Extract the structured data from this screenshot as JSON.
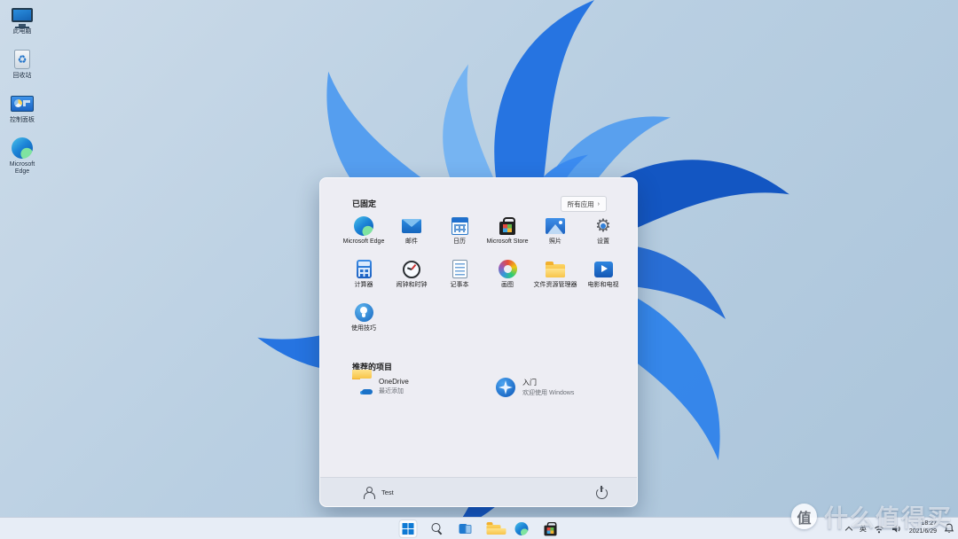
{
  "desktop": {
    "icons": [
      {
        "label": "此电脑",
        "icon": "this-pc-icon"
      },
      {
        "label": "回收站",
        "icon": "recycle-bin-icon"
      },
      {
        "label": "控制面板",
        "icon": "control-panel-icon"
      },
      {
        "label": "Microsoft Edge",
        "icon": "edge-icon"
      }
    ],
    "recycle_glyph": "♻"
  },
  "start_menu": {
    "pinned_header": "已固定",
    "all_apps_label": "所有应用",
    "all_apps_chevron": "›",
    "pinned_apps": [
      {
        "label": "Microsoft Edge"
      },
      {
        "label": "邮件"
      },
      {
        "label": "日历"
      },
      {
        "label": "Microsoft Store"
      },
      {
        "label": "照片"
      },
      {
        "label": "设置"
      },
      {
        "label": "计算器"
      },
      {
        "label": "闹钟和时钟"
      },
      {
        "label": "记事本"
      },
      {
        "label": "画图"
      },
      {
        "label": "文件资源管理器"
      },
      {
        "label": "电影和电视"
      },
      {
        "label": "使用技巧"
      }
    ],
    "settings_gear_glyph": "⚙",
    "recommended_header": "推荐的项目",
    "recommended": [
      {
        "title": "OneDrive",
        "subtitle": "最近添加"
      },
      {
        "title": "入门",
        "subtitle": "欢迎使用 Windows"
      }
    ],
    "user_name": "Test"
  },
  "taskbar": {
    "buttons": [
      {
        "name": "start"
      },
      {
        "name": "search"
      },
      {
        "name": "task-view"
      },
      {
        "name": "file-explorer"
      },
      {
        "name": "edge"
      },
      {
        "name": "microsoft-store"
      }
    ]
  },
  "tray": {
    "language": "英",
    "time": "18:27",
    "date": "2021/6/29"
  },
  "watermark": {
    "badge": "值",
    "text": "什么值得买"
  },
  "colors": {
    "accent_blue": "#0e7ad4",
    "bloom_deep": "#0b4fc0",
    "bloom_mid": "#1e6fe0",
    "bloom_light": "#4f9bef",
    "desktop_bg": "#b9cfe2",
    "menu_bg": "#ededf3",
    "taskbar_bg": "#e7edf6",
    "folder_yellow": "#f2b02e"
  }
}
